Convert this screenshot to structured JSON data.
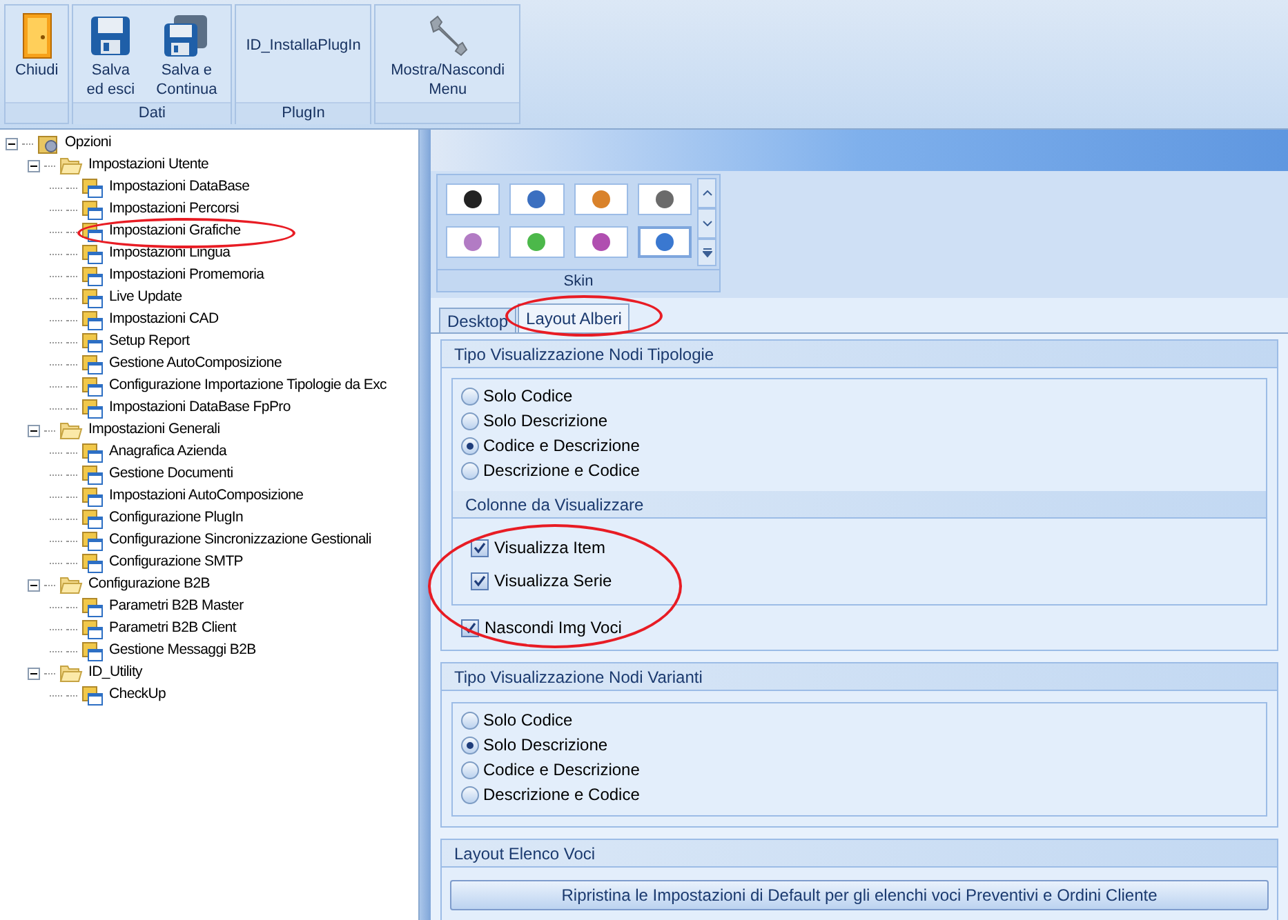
{
  "ribbon": {
    "groups": [
      {
        "buttons": [
          {
            "kind": "door",
            "label": "Chiudi"
          }
        ]
      },
      {
        "label": "Dati",
        "buttons": [
          {
            "kind": "disk",
            "label": "Salva ed esci"
          },
          {
            "kind": "disks",
            "label": "Salva e Continua"
          }
        ]
      },
      {
        "label": "PlugIn",
        "buttons": [
          {
            "kind": "text",
            "label": "ID_InstallaPlugIn"
          }
        ]
      },
      {
        "buttons": [
          {
            "kind": "wrench",
            "label": "Mostra/Nascondi Menu"
          }
        ]
      }
    ]
  },
  "tree": {
    "label": "Opzioni",
    "expanded": true,
    "children": [
      {
        "label": "Impostazioni Utente",
        "expanded": true,
        "children": [
          {
            "label": "Impostazioni DataBase"
          },
          {
            "label": "Impostazioni Percorsi"
          },
          {
            "label": "Impostazioni Grafiche"
          },
          {
            "label": "Impostazioni Lingua"
          },
          {
            "label": "Impostazioni Promemoria"
          },
          {
            "label": "Live Update"
          },
          {
            "label": "Impostazioni CAD"
          },
          {
            "label": "Setup Report"
          },
          {
            "label": "Gestione AutoComposizione"
          },
          {
            "label": "Configurazione Importazione Tipologie da Exc"
          },
          {
            "label": "Impostazioni DataBase FpPro"
          }
        ]
      },
      {
        "label": "Impostazioni Generali",
        "expanded": true,
        "children": [
          {
            "label": "Anagrafica Azienda"
          },
          {
            "label": "Gestione Documenti"
          },
          {
            "label": "Impostazioni AutoComposizione"
          },
          {
            "label": "Configurazione PlugIn"
          },
          {
            "label": "Configurazione Sincronizzazione Gestionali"
          },
          {
            "label": "Configurazione SMTP"
          }
        ]
      },
      {
        "label": "Configurazione B2B",
        "expanded": true,
        "children": [
          {
            "label": "Parametri B2B Master"
          },
          {
            "label": "Parametri B2B Client"
          },
          {
            "label": "Gestione Messaggi B2B"
          }
        ]
      },
      {
        "label": "ID_Utility",
        "expanded": true,
        "children": [
          {
            "label": "CheckUp"
          }
        ]
      }
    ]
  },
  "skin_gallery": {
    "label": "Skin",
    "skins": [
      {
        "color": "#222222",
        "selected": false
      },
      {
        "color": "#3b6fc0",
        "selected": false
      },
      {
        "color": "#d9822b",
        "selected": false
      },
      {
        "color": "#6b6b6b",
        "selected": false
      },
      {
        "color": "#b27bc4",
        "selected": false
      },
      {
        "color": "#4cb84a",
        "selected": false
      },
      {
        "color": "#b04fb0",
        "selected": false
      },
      {
        "color": "#3a78d0",
        "selected": true
      }
    ]
  },
  "tabs": [
    {
      "label": "Desktop",
      "selected": false
    },
    {
      "label": "Layout Alberi",
      "selected": true
    }
  ],
  "tipologie": {
    "title": "Tipo Visualizzazione Nodi Tipologie",
    "options": [
      {
        "label": "Solo Codice",
        "selected": false
      },
      {
        "label": "Solo Descrizione",
        "selected": false
      },
      {
        "label": "Codice e Descrizione",
        "selected": true
      },
      {
        "label": "Descrizione e Codice",
        "selected": false
      }
    ],
    "columns_title": "Colonne da Visualizzare",
    "columns": [
      {
        "label": "Visualizza Item",
        "checked": true
      },
      {
        "label": "Visualizza Serie",
        "checked": true
      }
    ],
    "hide_images": {
      "label": "Nascondi Img Voci",
      "checked": true
    }
  },
  "varianti": {
    "title": "Tipo Visualizzazione Nodi Varianti",
    "options": [
      {
        "label": "Solo Codice",
        "selected": false
      },
      {
        "label": "Solo Descrizione",
        "selected": true
      },
      {
        "label": "Codice e Descrizione",
        "selected": false
      },
      {
        "label": "Descrizione e Codice",
        "selected": false
      }
    ]
  },
  "elenco_voci": {
    "title": "Layout Elenco Voci",
    "button": "Ripristina le Impostazioni di Default per gli elenchi voci Preventivi e Ordini Cliente"
  }
}
